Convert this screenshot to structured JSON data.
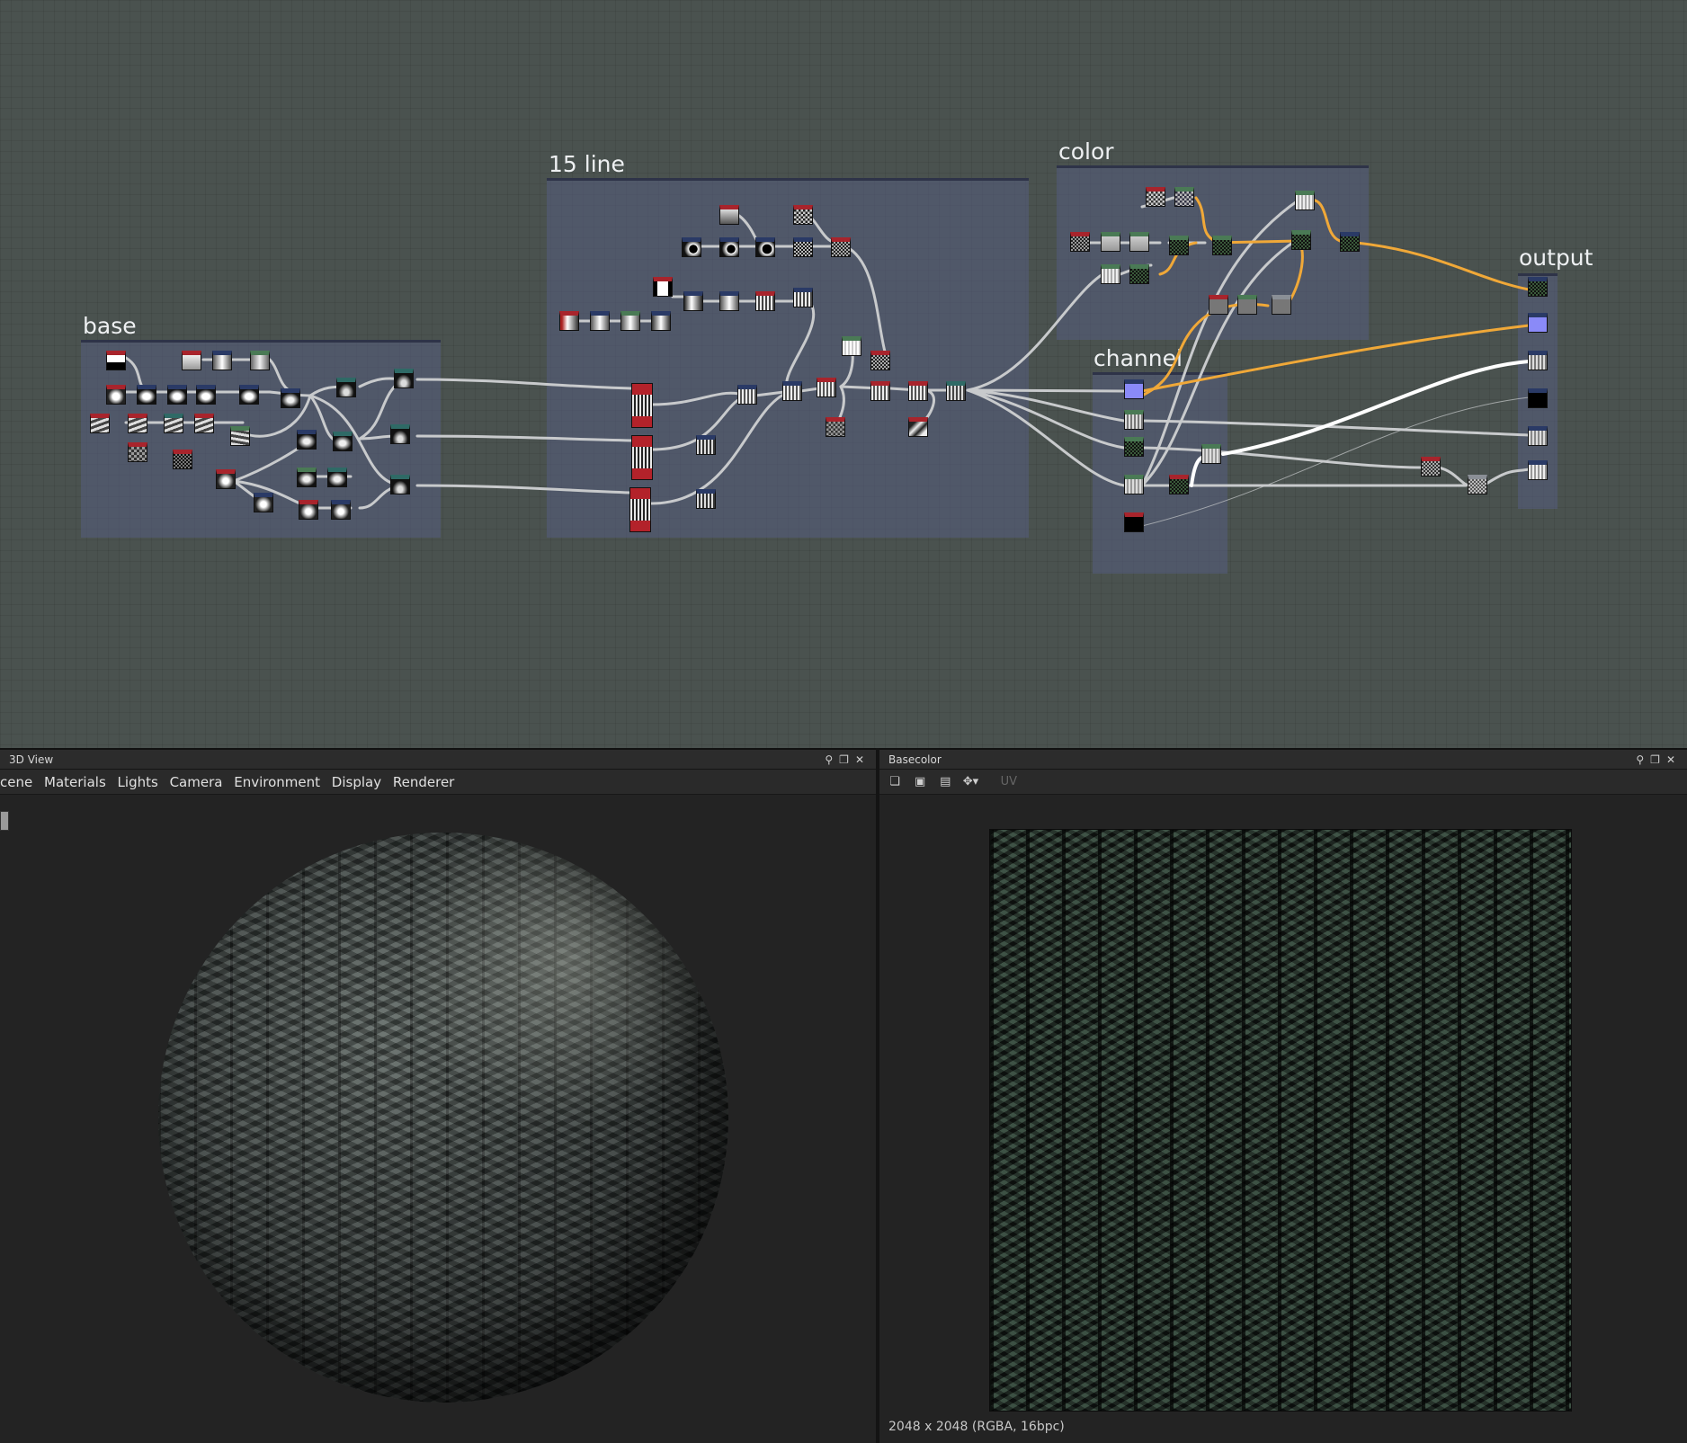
{
  "graph": {
    "frames": [
      {
        "id": "base",
        "title": "base"
      },
      {
        "id": "line",
        "title": "15 line"
      },
      {
        "id": "color",
        "title": "color"
      },
      {
        "id": "channel",
        "title": "channel"
      },
      {
        "id": "output",
        "title": "output"
      }
    ],
    "wire_colors": {
      "default": "#c8cacc",
      "highlight": "#f0a838",
      "selected": "#ffffff"
    },
    "node_accents": {
      "red": "#a8242c",
      "green": "#4a7a55",
      "blue": "#2a3a66",
      "teal": "#2f6a66",
      "gray": "#8a8f96",
      "normal_output": "#8a8af8"
    }
  },
  "view3d": {
    "title": "3D View",
    "menu": [
      "cene",
      "Materials",
      "Lights",
      "Camera",
      "Environment",
      "Display",
      "Renderer"
    ]
  },
  "view2d": {
    "title": "Basecolor",
    "toolbar": {
      "uv_label": "UV"
    },
    "status": "2048 x 2048 (RGBA, 16bpc)"
  },
  "icons": {
    "pin": "pin-icon",
    "float": "float-icon",
    "close": "close-icon"
  }
}
